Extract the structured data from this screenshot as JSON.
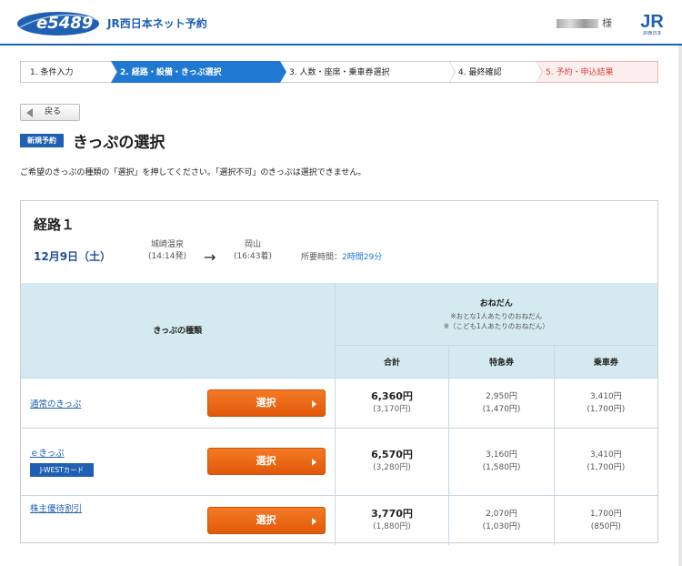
{
  "header": {
    "logo_text": "e5489",
    "app_title": "JR西日本ネット予約",
    "user_suffix": "様",
    "jr_logo_text": "JR西日本",
    "brand_color": "#1f60b3"
  },
  "steps": [
    {
      "label": "1. 条件入力",
      "state": "done"
    },
    {
      "label": "2. 経路・設備・きっぷ選択",
      "state": "active"
    },
    {
      "label": "3. 人数・座席・乗車券選択",
      "state": "todo"
    },
    {
      "label": "4. 最終確認",
      "state": "todo"
    },
    {
      "label": "5. 予約・申込結果",
      "state": "last"
    }
  ],
  "back_label": "戻る",
  "new_badge": "新規予約",
  "page_title": "きっぷの選択",
  "instruction": "ご希望のきっぷの種類の「選択」を押してください。「選択不可」のきっぷは選択できません。",
  "route": {
    "title": "経路１",
    "date": "12月9日（土）",
    "from_station": "城崎温泉",
    "from_time": "(14:14発)",
    "arrow": "→",
    "to_station": "岡山",
    "to_time": "(16:43着)",
    "duration_label": "所要時間：",
    "duration_value": "2時間29分"
  },
  "table": {
    "kind_header": "きっぷの種類",
    "price_header": "おねだん",
    "price_note1": "※おとな1人あたりのおねだん",
    "price_note2": "※（こども1人あたりのおねだん）",
    "col_total": "合計",
    "col_express": "特急券",
    "col_fare": "乗車券",
    "select_label": "選択",
    "rows": [
      {
        "name": "通常のきっぷ",
        "badge": "",
        "total": "6,360円",
        "total_child": "(3,170円)",
        "express": "2,950円",
        "express_child": "(1,470円)",
        "fare": "3,410円",
        "fare_child": "(1,700円)"
      },
      {
        "name": "ｅきっぷ",
        "badge": "J-WESTカード",
        "total": "6,570円",
        "total_child": "(3,280円)",
        "express": "3,160円",
        "express_child": "(1,580円)",
        "fare": "3,410円",
        "fare_child": "(1,700円)"
      },
      {
        "name": "株主優待割引",
        "badge": "",
        "total": "3,770円",
        "total_child": "(1,880円)",
        "express": "2,070円",
        "express_child": "(1,030円)",
        "fare": "1,700円",
        "fare_child": "(850円)"
      }
    ]
  }
}
